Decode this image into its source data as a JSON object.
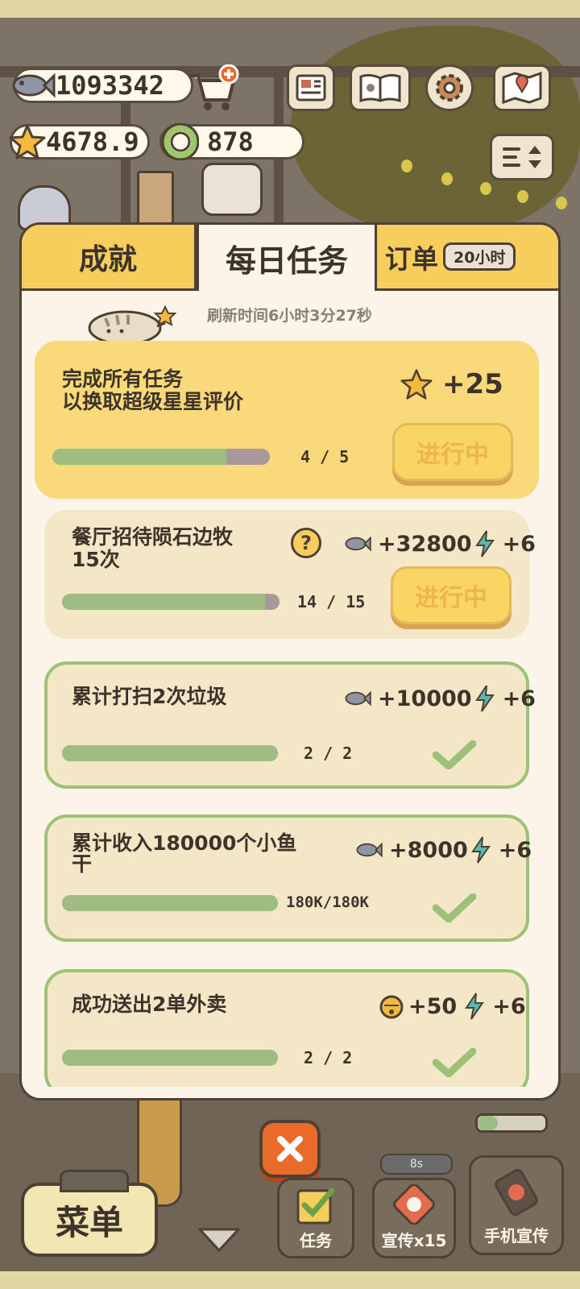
{
  "hud": {
    "fish_count": "1093342",
    "star_rating": "4678.9",
    "coin_count": "878"
  },
  "tabs": {
    "achievements": "成就",
    "daily_tasks": "每日任务",
    "orders": "订单",
    "orders_timer": "20小时"
  },
  "refresh_text": "刷新时间6小时3分27秒",
  "tasks": [
    {
      "title_line1": "完成所有任务",
      "title_line2": "以换取超级星星评价",
      "reward_star": "+25",
      "progress_text": "4  /  5",
      "progress": 0.8,
      "button": "进行中"
    },
    {
      "title_line1": "餐厅招待陨石边牧",
      "title_line2": "15次",
      "help": "?",
      "reward_fish": "+32800",
      "reward_energy": "+6",
      "progress_text": "14  /  15",
      "progress": 0.933,
      "button": "进行中"
    },
    {
      "title_line1": "累计打扫2次垃圾",
      "reward_fish": "+10000",
      "reward_energy": "+6",
      "progress_text": "2  /  2",
      "progress": 1.0
    },
    {
      "title_line1": "累计收入180000个小鱼",
      "title_line2": "干",
      "reward_fish": "+8000",
      "reward_energy": "+6",
      "progress_text": "180K/180K",
      "progress": 1.0
    },
    {
      "title_line1": "成功送出2单外卖",
      "reward_bell": "+50",
      "reward_energy": "+6",
      "progress_text": "2  /  2",
      "progress": 1.0
    }
  ],
  "bottom": {
    "menu": "菜单",
    "tasks": "任务",
    "promote": "宣传x15",
    "phone_promote": "手机宣传",
    "timer": "8s"
  },
  "colors": {
    "accent_yellow": "#f7cd5c",
    "progress_green": "#9fbd83",
    "panel_bg": "#fbf5e9",
    "close_orange": "#ea6a2a"
  }
}
